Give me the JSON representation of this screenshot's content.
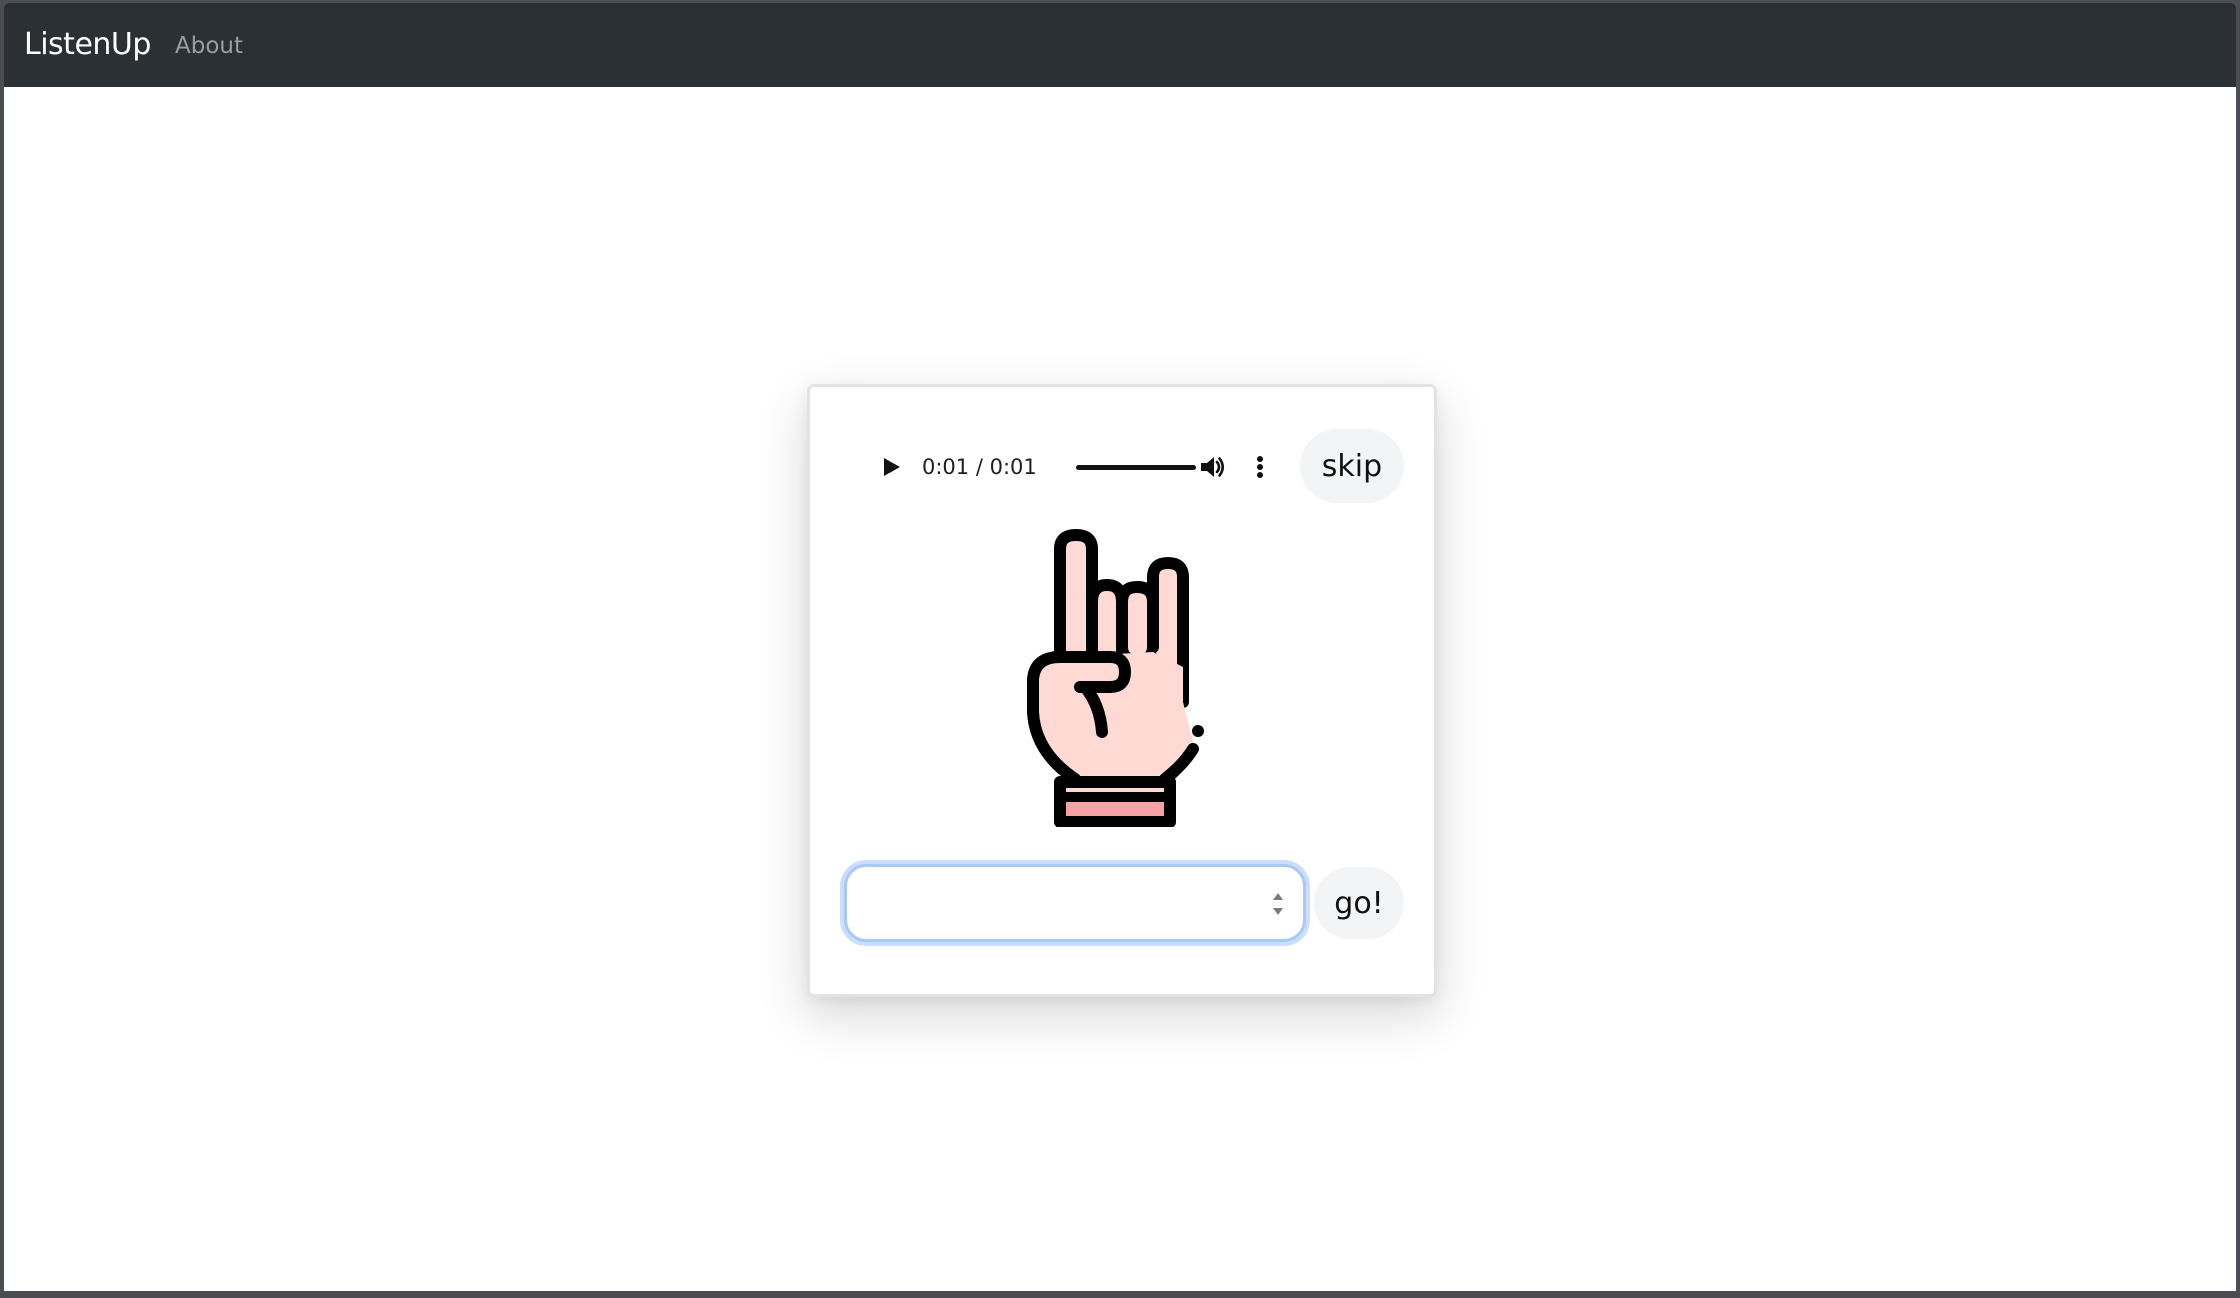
{
  "navbar": {
    "brand": "ListenUp",
    "links": [
      {
        "label": "About"
      }
    ]
  },
  "player": {
    "time_display": "0:01 / 0:01",
    "progress": 1.0,
    "play_icon": "play-icon",
    "volume_icon": "volume-icon",
    "more_icon": "more-vertical-icon"
  },
  "card": {
    "skip_label": "skip",
    "go_label": "go!",
    "answer_value": "",
    "image_icon": "rock-hand-icon"
  },
  "colors": {
    "navbar_bg": "#2b3035",
    "skin": "#ffd9d3",
    "cuff": "#f5a3a3",
    "focus_ring": "#a8c8f5"
  }
}
